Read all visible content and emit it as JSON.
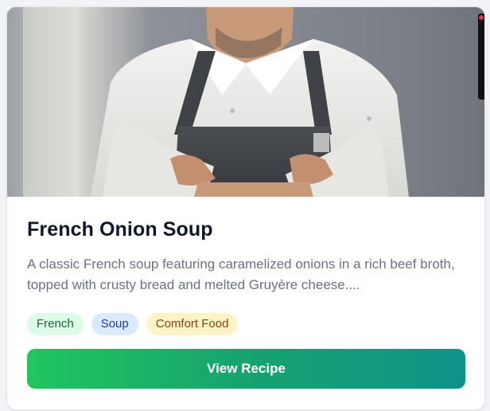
{
  "recipe": {
    "title": "French Onion Soup",
    "description": "A classic French soup featuring caramelized onions in a rich beef broth, topped with crusty bread and melted Gruyère cheese....",
    "tags": [
      {
        "label": "French",
        "color": "#dcfce7"
      },
      {
        "label": "Soup",
        "color": "#dbeafe"
      },
      {
        "label": "Comfort Food",
        "color": "#fef3c7"
      }
    ],
    "button_label": "View Recipe",
    "image_alt": "chef-photo"
  },
  "theme": {
    "button_gradient_start": "#22c55e",
    "button_gradient_end": "#0d9488",
    "title_color": "#0f172a"
  }
}
